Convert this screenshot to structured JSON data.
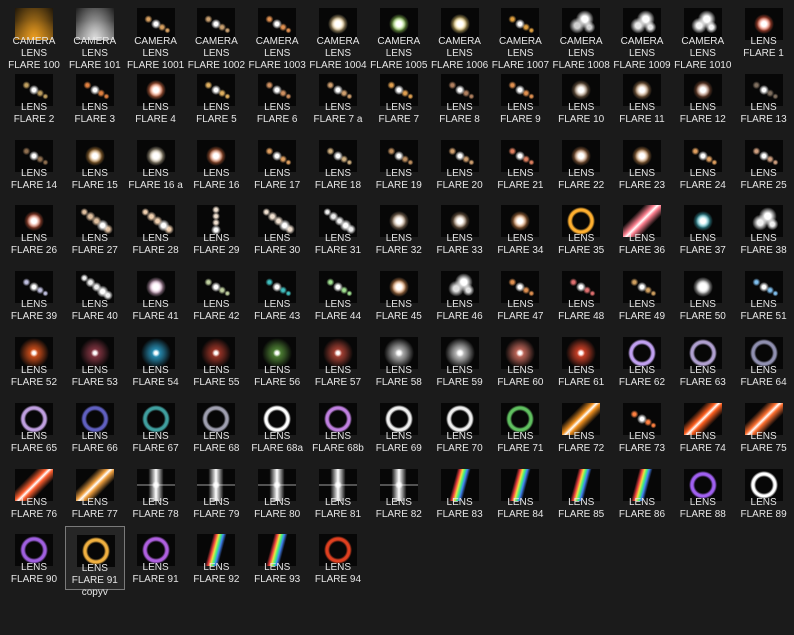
{
  "files": [
    {
      "line1": "CAMERA",
      "line2": "LENS",
      "line3": "FLARE 100",
      "icon": "camera-flare-icon",
      "style": "beam",
      "color": "#f0a020"
    },
    {
      "line1": "CAMERA",
      "line2": "LENS",
      "line3": "FLARE 101",
      "icon": "camera-flare-icon",
      "style": "beam",
      "color": "#e0e0e0"
    },
    {
      "line1": "CAMERA",
      "line2": "LENS",
      "line3": "FLARE 1001",
      "icon": "camera-flare-icon",
      "style": "dots",
      "color": "#d8a060"
    },
    {
      "line1": "CAMERA",
      "line2": "LENS",
      "line3": "FLARE 1002",
      "icon": "camera-flare-icon",
      "style": "dots",
      "color": "#c9a070"
    },
    {
      "line1": "CAMERA",
      "line2": "LENS",
      "line3": "FLARE 1003",
      "icon": "camera-flare-icon",
      "style": "dots",
      "color": "#e09050"
    },
    {
      "line1": "CAMERA",
      "line2": "LENS",
      "line3": "FLARE 1004",
      "icon": "camera-flare-icon",
      "style": "dot",
      "color": "#ffe0a0"
    },
    {
      "line1": "CAMERA",
      "line2": "LENS",
      "line3": "FLARE 1005",
      "icon": "camera-flare-icon",
      "style": "dot",
      "color": "#a0e060"
    },
    {
      "line1": "CAMERA",
      "line2": "LENS",
      "line3": "FLARE 1006",
      "icon": "camera-flare-icon",
      "style": "dot",
      "color": "#ffe080"
    },
    {
      "line1": "CAMERA",
      "line2": "LENS",
      "line3": "FLARE 1007",
      "icon": "camera-flare-icon",
      "style": "dots",
      "color": "#e0a040"
    },
    {
      "line1": "CAMERA",
      "line2": "LENS",
      "line3": "FLARE 1008",
      "icon": "camera-flare-icon",
      "style": "blobs",
      "color": "#d0d0d0"
    },
    {
      "line1": "CAMERA",
      "line2": "LENS",
      "line3": "FLARE 1009",
      "icon": "camera-flare-icon",
      "style": "blobs",
      "color": "#e8e8e8"
    },
    {
      "line1": "CAMERA",
      "line2": "LENS",
      "line3": "FLARE 1010",
      "icon": "camera-flare-icon",
      "style": "blobs",
      "color": "#f4f4f4"
    },
    {
      "line1": "LENS",
      "line2": "FLARE 1",
      "line3": "",
      "icon": "lens-flare-icon",
      "style": "dot",
      "color": "#ff6040"
    },
    {
      "line1": "LENS",
      "line2": "FLARE 2",
      "line3": "",
      "icon": "lens-flare-icon",
      "style": "dots",
      "color": "#c0a060"
    },
    {
      "line1": "LENS",
      "line2": "FLARE 3",
      "line3": "",
      "icon": "lens-flare-icon",
      "style": "dots",
      "color": "#e08040"
    },
    {
      "line1": "LENS",
      "line2": "FLARE 4",
      "line3": "",
      "icon": "lens-flare-icon",
      "style": "dot",
      "color": "#ff8050"
    },
    {
      "line1": "LENS",
      "line2": "FLARE 5",
      "line3": "",
      "icon": "lens-flare-icon",
      "style": "dots",
      "color": "#e0b060"
    },
    {
      "line1": "LENS",
      "line2": "FLARE 6",
      "line3": "",
      "icon": "lens-flare-icon",
      "style": "dots",
      "color": "#d09060"
    },
    {
      "line1": "LENS",
      "line2": "FLARE 7 a",
      "line3": "",
      "icon": "lens-flare-icon",
      "style": "dots",
      "color": "#d0a070"
    },
    {
      "line1": "LENS",
      "line2": "FLARE 7",
      "line3": "",
      "icon": "lens-flare-icon",
      "style": "dots",
      "color": "#e0a050"
    },
    {
      "line1": "LENS",
      "line2": "FLARE 8",
      "line3": "",
      "icon": "lens-flare-icon",
      "style": "dots",
      "color": "#b08060"
    },
    {
      "line1": "LENS",
      "line2": "FLARE 9",
      "line3": "",
      "icon": "lens-flare-icon",
      "style": "dots",
      "color": "#e09050"
    },
    {
      "line1": "LENS",
      "line2": "FLARE 10",
      "line3": "",
      "icon": "lens-flare-icon",
      "style": "dot",
      "color": "#a08060"
    },
    {
      "line1": "LENS",
      "line2": "FLARE 11",
      "line3": "",
      "icon": "lens-flare-icon",
      "style": "dot",
      "color": "#c09060"
    },
    {
      "line1": "LENS",
      "line2": "FLARE 12",
      "line3": "",
      "icon": "lens-flare-icon",
      "style": "dot",
      "color": "#a06040"
    },
    {
      "line1": "LENS",
      "line2": "FLARE 13",
      "line3": "",
      "icon": "lens-flare-icon",
      "style": "dots",
      "color": "#807060"
    },
    {
      "line1": "LENS",
      "line2": "FLARE 14",
      "line3": "",
      "icon": "lens-flare-icon",
      "style": "dots",
      "color": "#907050"
    },
    {
      "line1": "LENS",
      "line2": "FLARE 15",
      "line3": "",
      "icon": "lens-flare-icon",
      "style": "dot",
      "color": "#d09040"
    },
    {
      "line1": "LENS",
      "line2": "FLARE 16 a",
      "line3": "",
      "icon": "lens-flare-icon",
      "style": "dot",
      "color": "#e0d0b0"
    },
    {
      "line1": "LENS",
      "line2": "FLARE 16",
      "line3": "",
      "icon": "lens-flare-icon",
      "style": "dot",
      "color": "#e07040"
    },
    {
      "line1": "LENS",
      "line2": "FLARE 17",
      "line3": "",
      "icon": "lens-flare-icon",
      "style": "dots",
      "color": "#e0a060"
    },
    {
      "line1": "LENS",
      "line2": "FLARE 18",
      "line3": "",
      "icon": "lens-flare-icon",
      "style": "dots",
      "color": "#d0b080"
    },
    {
      "line1": "LENS",
      "line2": "FLARE 19",
      "line3": "",
      "icon": "lens-flare-icon",
      "style": "dots",
      "color": "#c09060"
    },
    {
      "line1": "LENS",
      "line2": "FLARE 20",
      "line3": "",
      "icon": "lens-flare-icon",
      "style": "dots",
      "color": "#d0a070"
    },
    {
      "line1": "LENS",
      "line2": "FLARE 21",
      "line3": "",
      "icon": "lens-flare-icon",
      "style": "dots",
      "color": "#e08060"
    },
    {
      "line1": "LENS",
      "line2": "FLARE 22",
      "line3": "",
      "icon": "lens-flare-icon",
      "style": "dot",
      "color": "#c08050"
    },
    {
      "line1": "LENS",
      "line2": "FLARE 23",
      "line3": "",
      "icon": "lens-flare-icon",
      "style": "dot",
      "color": "#d09050"
    },
    {
      "line1": "LENS",
      "line2": "FLARE 24",
      "line3": "",
      "icon": "lens-flare-icon",
      "style": "dots",
      "color": "#e0a060"
    },
    {
      "line1": "LENS",
      "line2": "FLARE 25",
      "line3": "",
      "icon": "lens-flare-icon",
      "style": "dots",
      "color": "#d0a080"
    },
    {
      "line1": "LENS",
      "line2": "FLARE 26",
      "line3": "",
      "icon": "lens-flare-icon",
      "style": "dot",
      "color": "#e06040"
    },
    {
      "line1": "LENS",
      "line2": "FLARE 27",
      "line3": "",
      "icon": "lens-flare-icon",
      "style": "diag",
      "color": "#e0c0a0"
    },
    {
      "line1": "LENS",
      "line2": "FLARE 28",
      "line3": "",
      "icon": "lens-flare-icon",
      "style": "diag",
      "color": "#f0d0b0"
    },
    {
      "line1": "LENS",
      "line2": "FLARE 29",
      "line3": "",
      "icon": "lens-flare-icon",
      "style": "vert",
      "color": "#f0e0d0"
    },
    {
      "line1": "LENS",
      "line2": "FLARE 30",
      "line3": "",
      "icon": "lens-flare-icon",
      "style": "diag",
      "color": "#f0e0d0"
    },
    {
      "line1": "LENS",
      "line2": "FLARE 31",
      "line3": "",
      "icon": "lens-flare-icon",
      "style": "diag",
      "color": "#f0f0f0"
    },
    {
      "line1": "LENS",
      "line2": "FLARE 32",
      "line3": "",
      "icon": "lens-flare-icon",
      "style": "dot",
      "color": "#c0a080"
    },
    {
      "line1": "LENS",
      "line2": "FLARE 33",
      "line3": "",
      "icon": "lens-flare-icon",
      "style": "dot",
      "color": "#a08060"
    },
    {
      "line1": "LENS",
      "line2": "FLARE 34",
      "line3": "",
      "icon": "lens-flare-icon",
      "style": "dot",
      "color": "#e09050"
    },
    {
      "line1": "LENS",
      "line2": "FLARE 35",
      "line3": "",
      "icon": "lens-flare-icon",
      "style": "ring",
      "color": "#ffb030"
    },
    {
      "line1": "LENS",
      "line2": "FLARE 36",
      "line3": "",
      "icon": "lens-flare-icon",
      "style": "streak",
      "color": "#ff8090"
    },
    {
      "line1": "LENS",
      "line2": "FLARE 37",
      "line3": "",
      "icon": "lens-flare-icon",
      "style": "dot",
      "color": "#40c0d0"
    },
    {
      "line1": "LENS",
      "line2": "FLARE 38",
      "line3": "",
      "icon": "lens-flare-icon",
      "style": "blobs",
      "color": "#f0f0f0"
    },
    {
      "line1": "LENS",
      "line2": "FLARE 39",
      "line3": "",
      "icon": "lens-flare-icon",
      "style": "dots",
      "color": "#c0c0e0"
    },
    {
      "line1": "LENS",
      "line2": "FLARE 40",
      "line3": "",
      "icon": "lens-flare-icon",
      "style": "diag",
      "color": "#f0f0f0"
    },
    {
      "line1": "LENS",
      "line2": "FLARE 41",
      "line3": "",
      "icon": "lens-flare-icon",
      "style": "dot",
      "color": "#f0c0e0"
    },
    {
      "line1": "LENS",
      "line2": "FLARE 42",
      "line3": "",
      "icon": "lens-flare-icon",
      "style": "dots",
      "color": "#c0d0a0"
    },
    {
      "line1": "LENS",
      "line2": "FLARE 43",
      "line3": "",
      "icon": "lens-flare-icon",
      "style": "dots",
      "color": "#40c0c0"
    },
    {
      "line1": "LENS",
      "line2": "FLARE 44",
      "line3": "",
      "icon": "lens-flare-icon",
      "style": "dots",
      "color": "#a0e090"
    },
    {
      "line1": "LENS",
      "line2": "FLARE 45",
      "line3": "",
      "icon": "lens-flare-icon",
      "style": "dot",
      "color": "#f0a060"
    },
    {
      "line1": "LENS",
      "line2": "FLARE 46",
      "line3": "",
      "icon": "lens-flare-icon",
      "style": "blobs",
      "color": "#e0e0e0"
    },
    {
      "line1": "LENS",
      "line2": "FLARE 47",
      "line3": "",
      "icon": "lens-flare-icon",
      "style": "dots",
      "color": "#e09050"
    },
    {
      "line1": "LENS",
      "line2": "FLARE 48",
      "line3": "",
      "icon": "lens-flare-icon",
      "style": "dots",
      "color": "#e07070"
    },
    {
      "line1": "LENS",
      "line2": "FLARE 49",
      "line3": "",
      "icon": "lens-flare-icon",
      "style": "dots",
      "color": "#d0a060"
    },
    {
      "line1": "LENS",
      "line2": "FLARE 50",
      "line3": "",
      "icon": "lens-flare-icon",
      "style": "dot",
      "color": "#f0f0f0"
    },
    {
      "line1": "LENS",
      "line2": "FLARE 51",
      "line3": "",
      "icon": "lens-flare-icon",
      "style": "dots",
      "color": "#80c0f0"
    },
    {
      "line1": "LENS",
      "line2": "FLARE 52",
      "line3": "",
      "icon": "lens-flare-icon",
      "style": "glow",
      "color": "#ff6020"
    },
    {
      "line1": "LENS",
      "line2": "FLARE 53",
      "line3": "",
      "icon": "lens-flare-icon",
      "style": "glow",
      "color": "#a04050"
    },
    {
      "line1": "LENS",
      "line2": "FLARE 54",
      "line3": "",
      "icon": "lens-flare-icon",
      "style": "glow",
      "color": "#30b0e0"
    },
    {
      "line1": "LENS",
      "line2": "FLARE 55",
      "line3": "",
      "icon": "lens-flare-icon",
      "style": "glow",
      "color": "#c04030"
    },
    {
      "line1": "LENS",
      "line2": "FLARE 56",
      "line3": "",
      "icon": "lens-flare-icon",
      "style": "glow",
      "color": "#60a040"
    },
    {
      "line1": "LENS",
      "line2": "FLARE 57",
      "line3": "",
      "icon": "lens-flare-icon",
      "style": "glow",
      "color": "#d05040"
    },
    {
      "line1": "LENS",
      "line2": "FLARE 58",
      "line3": "",
      "icon": "lens-flare-icon",
      "style": "glow",
      "color": "#e0e0e0"
    },
    {
      "line1": "LENS",
      "line2": "FLARE 59",
      "line3": "",
      "icon": "lens-flare-icon",
      "style": "glow",
      "color": "#f0f0f0"
    },
    {
      "line1": "LENS",
      "line2": "FLARE 60",
      "line3": "",
      "icon": "lens-flare-icon",
      "style": "glow",
      "color": "#f08070"
    },
    {
      "line1": "LENS",
      "line2": "FLARE 61",
      "line3": "",
      "icon": "lens-flare-icon",
      "style": "glow",
      "color": "#ff5030"
    },
    {
      "line1": "LENS",
      "line2": "FLARE 62",
      "line3": "",
      "icon": "lens-flare-icon",
      "style": "ring",
      "color": "#c0a0f0"
    },
    {
      "line1": "LENS",
      "line2": "FLARE 63",
      "line3": "",
      "icon": "lens-flare-icon",
      "style": "ring",
      "color": "#b0a0d0"
    },
    {
      "line1": "LENS",
      "line2": "FLARE 64",
      "line3": "",
      "icon": "lens-flare-icon",
      "style": "ring",
      "color": "#9090b0"
    },
    {
      "line1": "LENS",
      "line2": "FLARE 65",
      "line3": "",
      "icon": "lens-flare-icon",
      "style": "ring",
      "color": "#c0a0e0"
    },
    {
      "line1": "LENS",
      "line2": "FLARE 66",
      "line3": "",
      "icon": "lens-flare-icon",
      "style": "ring",
      "color": "#6060c0"
    },
    {
      "line1": "LENS",
      "line2": "FLARE 67",
      "line3": "",
      "icon": "lens-flare-icon",
      "style": "ring",
      "color": "#40a0a0"
    },
    {
      "line1": "LENS",
      "line2": "FLARE 68",
      "line3": "",
      "icon": "lens-flare-icon",
      "style": "ring",
      "color": "#a0a0b0"
    },
    {
      "line1": "LENS",
      "line2": "FLARE 68a",
      "line3": "",
      "icon": "lens-flare-icon",
      "style": "ring",
      "color": "#ffffff"
    },
    {
      "line1": "LENS",
      "line2": "FLARE 68b",
      "line3": "",
      "icon": "lens-flare-icon",
      "style": "ring",
      "color": "#c080e0"
    },
    {
      "line1": "LENS",
      "line2": "FLARE 69",
      "line3": "",
      "icon": "lens-flare-icon",
      "style": "ring",
      "color": "#f0f0f0"
    },
    {
      "line1": "LENS",
      "line2": "FLARE 70",
      "line3": "",
      "icon": "lens-flare-icon",
      "style": "ring",
      "color": "#f0f0f0"
    },
    {
      "line1": "LENS",
      "line2": "FLARE 71",
      "line3": "",
      "icon": "lens-flare-icon",
      "style": "ring",
      "color": "#60c060"
    },
    {
      "line1": "LENS",
      "line2": "FLARE 72",
      "line3": "",
      "icon": "lens-flare-icon",
      "style": "streak",
      "color": "#f09020"
    },
    {
      "line1": "LENS",
      "line2": "FLARE 73",
      "line3": "",
      "icon": "lens-flare-icon",
      "style": "dots",
      "color": "#ff8040"
    },
    {
      "line1": "LENS",
      "line2": "FLARE 74",
      "line3": "",
      "icon": "lens-flare-icon",
      "style": "streak",
      "color": "#ff6020"
    },
    {
      "line1": "LENS",
      "line2": "FLARE 75",
      "line3": "",
      "icon": "lens-flare-icon",
      "style": "streak",
      "color": "#ff7030"
    },
    {
      "line1": "LENS",
      "line2": "FLARE 76",
      "line3": "",
      "icon": "lens-flare-icon",
      "style": "streak",
      "color": "#ff6030"
    },
    {
      "line1": "LENS",
      "line2": "FLARE 77",
      "line3": "",
      "icon": "lens-flare-icon",
      "style": "streak",
      "color": "#f0a040"
    },
    {
      "line1": "LENS",
      "line2": "FLARE 78",
      "line3": "",
      "icon": "lens-flare-icon",
      "style": "star",
      "color": "#ffffff"
    },
    {
      "line1": "LENS",
      "line2": "FLARE 79",
      "line3": "",
      "icon": "lens-flare-icon",
      "style": "star",
      "color": "#ffffff"
    },
    {
      "line1": "LENS",
      "line2": "FLARE 80",
      "line3": "",
      "icon": "lens-flare-icon",
      "style": "star",
      "color": "#ffffff"
    },
    {
      "line1": "LENS",
      "line2": "FLARE 81",
      "line3": "",
      "icon": "lens-flare-icon",
      "style": "star",
      "color": "#ffffff"
    },
    {
      "line1": "LENS",
      "line2": "FLARE 82",
      "line3": "",
      "icon": "lens-flare-icon",
      "style": "star",
      "color": "#ffffff"
    },
    {
      "line1": "LENS",
      "line2": "FLARE 83",
      "line3": "",
      "icon": "lens-flare-icon",
      "style": "prism",
      "color": "#f0c040"
    },
    {
      "line1": "LENS",
      "line2": "FLARE 84",
      "line3": "",
      "icon": "lens-flare-icon",
      "style": "prism",
      "color": "#a0c0f0"
    },
    {
      "line1": "LENS",
      "line2": "FLARE 85",
      "line3": "",
      "icon": "lens-flare-icon",
      "style": "prism",
      "color": "#4080f0"
    },
    {
      "line1": "LENS",
      "line2": "FLARE 86",
      "line3": "",
      "icon": "lens-flare-icon",
      "style": "prism",
      "color": "#f0a040"
    },
    {
      "line1": "LENS",
      "line2": "FLARE 88",
      "line3": "",
      "icon": "lens-flare-icon",
      "style": "ring",
      "color": "#a060f0"
    },
    {
      "line1": "LENS",
      "line2": "FLARE 89",
      "line3": "",
      "icon": "lens-flare-icon",
      "style": "ring",
      "color": "#ffffff"
    },
    {
      "line1": "LENS",
      "line2": "FLARE 90",
      "line3": "",
      "icon": "lens-flare-icon",
      "style": "ring",
      "color": "#a060e0"
    },
    {
      "line1": "LENS",
      "line2": "FLARE 91",
      "line3": "copyv",
      "icon": "lens-flare-icon",
      "style": "ring",
      "color": "#f0b040"
    },
    {
      "line1": "LENS",
      "line2": "FLARE 91",
      "line3": "",
      "icon": "lens-flare-icon",
      "style": "ring",
      "color": "#b060e0"
    },
    {
      "line1": "LENS",
      "line2": "FLARE 92",
      "line3": "",
      "icon": "lens-flare-icon",
      "style": "prism",
      "color": "#80a0f0"
    },
    {
      "line1": "LENS",
      "line2": "FLARE 93",
      "line3": "",
      "icon": "lens-flare-icon",
      "style": "prism",
      "color": "#60d080"
    },
    {
      "line1": "LENS",
      "line2": "FLARE 94",
      "line3": "",
      "icon": "lens-flare-icon",
      "style": "ring",
      "color": "#e04020"
    }
  ],
  "selected_index": 105,
  "colors": {
    "background": "#1b1b1b",
    "label": "#e6e6e6",
    "thumb": "#070707",
    "selection_border": "#7a7a7a"
  }
}
